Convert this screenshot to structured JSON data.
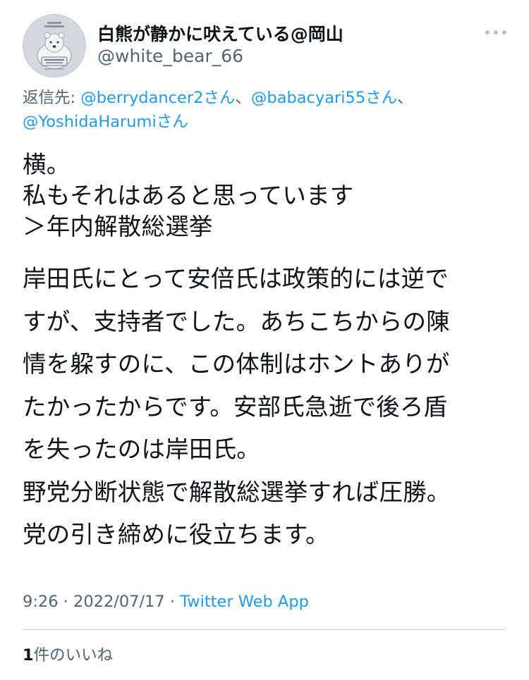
{
  "author": {
    "display_name": "白熊が静かに吠えている@岡山",
    "handle": "@white_bear_66",
    "avatar_label": "avatar"
  },
  "reply_to": {
    "prefix": "返信先: ",
    "mentions": [
      "@berrydancer2さん",
      "@babacyari55さん",
      "@YoshidaHarumiさん"
    ],
    "separator": "、"
  },
  "tweet": {
    "paragraph1": [
      "横。",
      "私もそれはあると思っています",
      "＞年内解散総選挙"
    ],
    "paragraph2": [
      "岸田氏にとって安倍氏は政策的には逆で",
      "すが、支持者でした。あちこちからの陳",
      "情を躱すのに、この体制はホントありが",
      "たかったからです。安部氏急逝で後ろ盾",
      "を失ったのは岸田氏。",
      "野党分断状態で解散総選挙すれば圧勝。",
      "党の引き締めに役立ちます。"
    ]
  },
  "meta": {
    "time": "9:26",
    "sep1": " · ",
    "date": "2022/07/17",
    "sep2": " · ",
    "source": "Twitter Web App"
  },
  "likes": {
    "count": "1",
    "label": "件のいいね"
  },
  "colors": {
    "text": "#0f1419",
    "secondary": "#536471",
    "link": "#1d9bf0",
    "divider": "#cfd9de"
  },
  "icons": {
    "more": "more-horizontal-icon"
  }
}
